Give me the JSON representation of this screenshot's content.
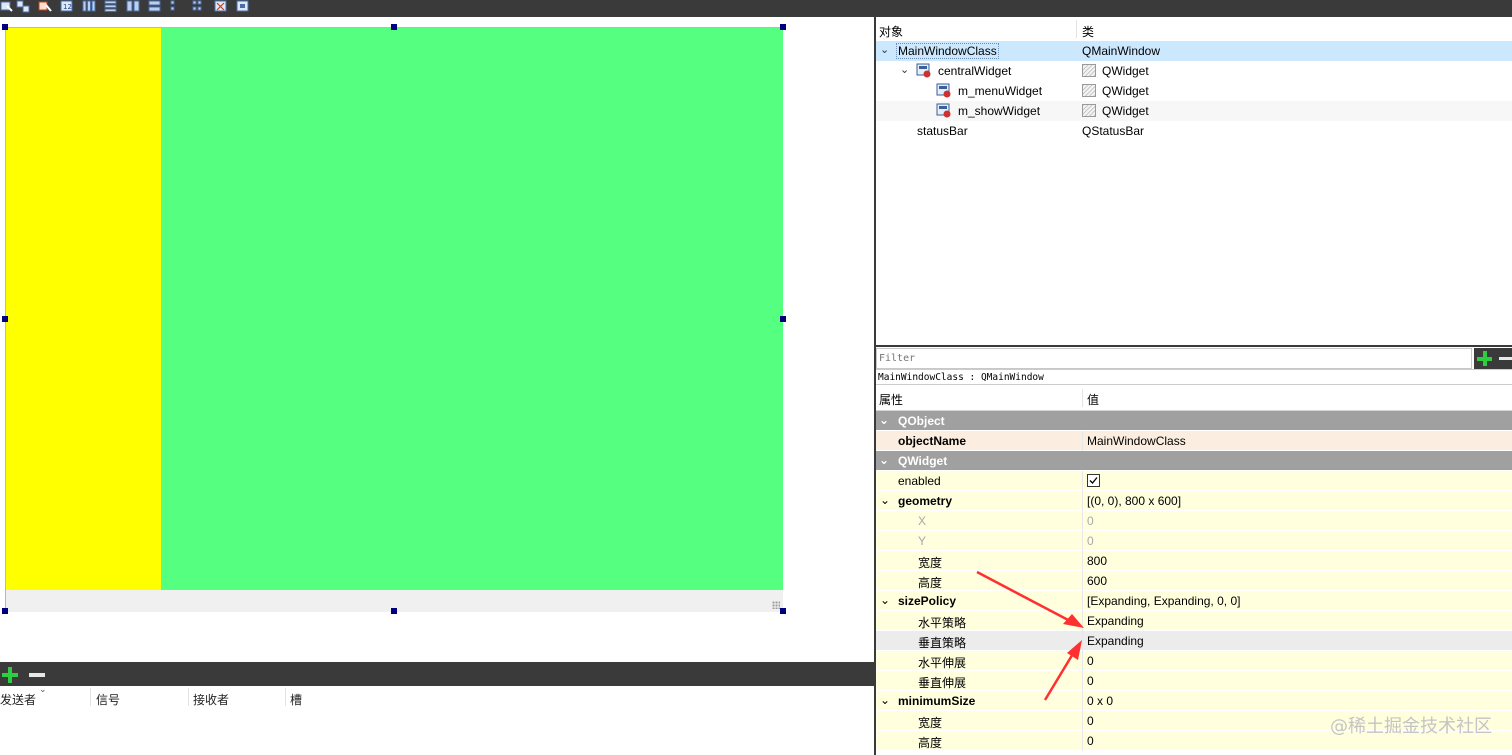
{
  "toolbar": {
    "buttons": [
      "edit-widgets-icon",
      "edit-signals-icon",
      "edit-buddies-icon",
      "edit-tab-order-icon",
      "layout-horizontal-icon",
      "layout-vertical-icon",
      "layout-horizontal-splitter-icon",
      "layout-vertical-splitter-icon",
      "layout-grid-icon",
      "layout-form-icon",
      "adjust-size-icon"
    ]
  },
  "form": {
    "menu_widget_color": "#ffff00",
    "show_widget_color": "#55ff7f"
  },
  "signal_slot": {
    "columns": [
      "发送者",
      "信号",
      "接收者",
      "槽"
    ]
  },
  "object_inspector": {
    "header": {
      "object": "对象",
      "class": "类"
    },
    "rows": [
      {
        "name": "MainWindowClass",
        "class": "QMainWindow"
      },
      {
        "name": "centralWidget",
        "class": "QWidget"
      },
      {
        "name": "m_menuWidget",
        "class": "QWidget"
      },
      {
        "name": "m_showWidget",
        "class": "QWidget"
      },
      {
        "name": "statusBar",
        "class": "QStatusBar"
      }
    ]
  },
  "property_editor": {
    "filter_placeholder": "Filter",
    "caption": "MainWindowClass : QMainWindow",
    "header": {
      "property": "属性",
      "value": "值"
    },
    "rows": [
      {
        "name": "QObject",
        "value": ""
      },
      {
        "name": "objectName",
        "value": "MainWindowClass"
      },
      {
        "name": "QWidget",
        "value": ""
      },
      {
        "name": "enabled",
        "value": "",
        "checked": true
      },
      {
        "name": "geometry",
        "value": "[(0, 0), 800 x 600]"
      },
      {
        "name": "X",
        "value": "0"
      },
      {
        "name": "Y",
        "value": "0"
      },
      {
        "name": "宽度",
        "value": "800"
      },
      {
        "name": "高度",
        "value": "600"
      },
      {
        "name": "sizePolicy",
        "value": "[Expanding, Expanding, 0, 0]"
      },
      {
        "name": "水平策略",
        "value": "Expanding"
      },
      {
        "name": "垂直策略",
        "value": "Expanding"
      },
      {
        "name": "水平伸展",
        "value": "0"
      },
      {
        "name": "垂直伸展",
        "value": "0"
      },
      {
        "name": "minimumSize",
        "value": "0 x 0"
      },
      {
        "name": "宽度",
        "value": "0"
      },
      {
        "name": "高度",
        "value": "0"
      }
    ]
  },
  "watermark": "@稀土掘金技术社区",
  "colors": {
    "dark_chrome": "#3a3a3a",
    "selection": "#cce8ff",
    "group_header": "#a0a0a0",
    "row_cream": "#ffffde",
    "row_pink": "#fbeee0",
    "annotation_arrow": "#ff3030"
  }
}
